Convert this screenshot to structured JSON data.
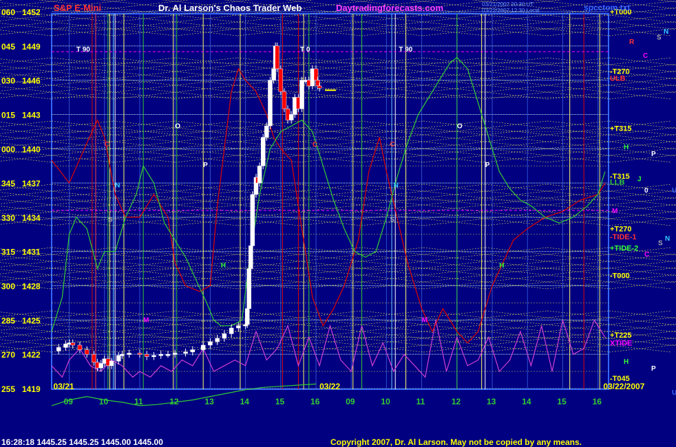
{
  "header": {
    "instrument": "S&P E-Mini",
    "site_title": "Dr. Al Larson's Chaos Trader Web",
    "site_url": "Daytradingforecasts.com",
    "date_line1": "03/21/2007 20:30 UT",
    "date_line2": "03/22/2007 12:30 Local",
    "file_name": "spcctom.txt"
  },
  "footer": {
    "quote": "16:28:18  1445.25 1445.25 1445.00 1445.00",
    "copyright": "Copyright 2007, Dr. Al Larson. May not be copied by any means."
  },
  "colors": {
    "background": "#000080",
    "price_up": "#ffffff",
    "price_down": "#ff0000",
    "grid_yellow": "#ffff66",
    "green_line": "#33cc33",
    "red_line": "#e00000",
    "magenta_line": "#d040d0",
    "axis_blue": "#3366ff",
    "label_red": "#ff3333",
    "label_magenta": "#ff00ff",
    "label_cyan": "#33ccff",
    "label_yellow": "#ffff00"
  },
  "chart_data": {
    "type": "line",
    "title": "S&P E-Mini",
    "y_ticks": [
      {
        "left": "060",
        "price": "1452",
        "value": 1452
      },
      {
        "left": "045",
        "price": "1449",
        "value": 1449
      },
      {
        "left": "030",
        "price": "1446",
        "value": 1446
      },
      {
        "left": "015",
        "price": "1443",
        "value": 1443
      },
      {
        "left": "000",
        "price": "1440",
        "value": 1440
      },
      {
        "left": "345",
        "price": "1437",
        "value": 1437
      },
      {
        "left": "330",
        "price": "1434",
        "value": 1434
      },
      {
        "left": "315",
        "price": "1431",
        "value": 1431
      },
      {
        "left": "300",
        "price": "1428",
        "value": 1428
      },
      {
        "left": "285",
        "price": "1425",
        "value": 1425
      },
      {
        "left": "270",
        "price": "1422",
        "value": 1422
      },
      {
        "left": "255",
        "price": "1419",
        "value": 1419
      }
    ],
    "ylim": [
      1419,
      1452
    ],
    "xlim": [
      8.5,
      24.3
    ],
    "x_ticks": [
      {
        "label": "09",
        "x": 9
      },
      {
        "label": "10",
        "x": 10
      },
      {
        "label": "11",
        "x": 11
      },
      {
        "label": "12",
        "x": 12
      },
      {
        "label": "13",
        "x": 13
      },
      {
        "label": "14",
        "x": 14
      },
      {
        "label": "15",
        "x": 15
      },
      {
        "label": "16",
        "x": 16
      },
      {
        "label": "09",
        "x": 17
      },
      {
        "label": "10",
        "x": 18
      },
      {
        "label": "11",
        "x": 19
      },
      {
        "label": "12",
        "x": 20
      },
      {
        "label": "13",
        "x": 21
      },
      {
        "label": "14",
        "x": 22
      },
      {
        "label": "15",
        "x": 23
      },
      {
        "label": "16",
        "x": 24
      }
    ],
    "date_labels": [
      {
        "text": "03/21",
        "x": 8.55,
        "color": "#ffff00"
      },
      {
        "text": "03/22",
        "x": 16.1,
        "color": "#ffff00"
      },
      {
        "text": "03/22/2007",
        "x": 24.15,
        "color": "#ffff00"
      }
    ],
    "price_series": {
      "name": "price",
      "x": [
        8.5,
        8.7,
        8.9,
        9.0,
        9.1,
        9.3,
        9.5,
        9.7,
        9.8,
        9.9,
        10.0,
        10.1,
        10.2,
        10.4,
        10.5,
        10.7,
        11.0,
        11.2,
        11.4,
        11.6,
        11.8,
        12.0,
        12.3,
        12.5,
        12.8,
        13.0,
        13.2,
        13.4,
        13.6,
        13.8,
        14.0,
        14.05,
        14.1,
        14.15,
        14.2,
        14.3,
        14.35,
        14.4,
        14.5,
        14.6,
        14.7,
        14.8,
        14.85,
        14.9,
        15.0,
        15.1,
        15.2,
        15.3,
        15.4,
        15.5,
        15.6,
        15.7,
        15.8,
        15.9,
        16.0,
        16.05,
        16.1
      ],
      "values": [
        1422.3,
        1422.6,
        1422.9,
        1423.0,
        1422.8,
        1422.4,
        1422.0,
        1421.3,
        1420.8,
        1421.2,
        1421.6,
        1421.0,
        1421.4,
        1421.9,
        1422.0,
        1422.1,
        1422.0,
        1421.8,
        1421.9,
        1422.0,
        1422.0,
        1422.1,
        1422.2,
        1422.4,
        1422.8,
        1423.1,
        1423.4,
        1423.8,
        1424.3,
        1424.5,
        1424.6,
        1426.0,
        1429.5,
        1431.5,
        1436.0,
        1437.5,
        1437.0,
        1438.5,
        1441.0,
        1442.0,
        1446.0,
        1447.0,
        1449.0,
        1447.0,
        1445.0,
        1443.5,
        1442.5,
        1443.0,
        1444.5,
        1443.5,
        1446.0,
        1446.0,
        1445.5,
        1447.0,
        1446.0,
        1445.5,
        1445.3
      ]
    },
    "red_flux": {
      "x": [
        8.5,
        9.0,
        9.5,
        9.8,
        10.0,
        10.3,
        10.6,
        11.0,
        11.4,
        11.8,
        12.0,
        12.3,
        12.7,
        13.0,
        13.2,
        13.4,
        13.6,
        13.8,
        14.0,
        14.3,
        14.6,
        14.8,
        15.0,
        15.3,
        15.6,
        15.9,
        16.2,
        16.5,
        16.8,
        17.2,
        17.5,
        17.8,
        18.0,
        18.3,
        18.6,
        19.0,
        19.3,
        19.6,
        20.0,
        20.3,
        20.6,
        21.0,
        21.3,
        21.6,
        22.0,
        22.5,
        23.0,
        23.5,
        24.0,
        24.2
      ],
      "values": [
        1439.0,
        1437.0,
        1440.5,
        1442.5,
        1441.0,
        1436.0,
        1434.0,
        1434.0,
        1436.0,
        1434.0,
        1430.0,
        1428.0,
        1427.5,
        1428.0,
        1435.0,
        1440.0,
        1445.0,
        1447.0,
        1446.0,
        1445.0,
        1443.0,
        1441.0,
        1440.0,
        1439.0,
        1433.0,
        1427.0,
        1424.5,
        1426.0,
        1428.0,
        1432.0,
        1438.0,
        1441.0,
        1438.0,
        1434.0,
        1430.0,
        1426.0,
        1424.0,
        1426.0,
        1424.0,
        1423.0,
        1424.0,
        1428.0,
        1430.0,
        1432.0,
        1433.0,
        1434.0,
        1434.5,
        1435.5,
        1436.0,
        1437.0
      ]
    },
    "green_flux": {
      "x": [
        8.5,
        8.8,
        9.0,
        9.2,
        9.5,
        9.8,
        10.0,
        10.3,
        10.6,
        10.9,
        11.1,
        11.4,
        11.7,
        12.0,
        12.3,
        12.6,
        12.9,
        13.1,
        13.3,
        13.6,
        13.9,
        14.1,
        14.4,
        14.7,
        15.0,
        15.3,
        15.6,
        15.9,
        16.2,
        16.5,
        16.8,
        17.1,
        17.4,
        17.7,
        18.0,
        18.3,
        18.6,
        18.9,
        19.2,
        19.5,
        19.8,
        20.0,
        20.3,
        20.6,
        20.9,
        21.2,
        21.5,
        21.8,
        22.1,
        22.5,
        22.9,
        23.3,
        23.7,
        24.0,
        24.2
      ],
      "values": [
        1424.0,
        1427.0,
        1432.5,
        1434.0,
        1433.0,
        1429.5,
        1431.0,
        1431.0,
        1434.0,
        1436.0,
        1438.5,
        1437.0,
        1433.5,
        1432.0,
        1430.5,
        1428.5,
        1426.5,
        1425.0,
        1424.5,
        1424.5,
        1425.0,
        1430.0,
        1436.0,
        1440.0,
        1441.5,
        1442.0,
        1442.5,
        1441.5,
        1438.5,
        1435.5,
        1433.0,
        1431.0,
        1430.5,
        1431.0,
        1434.0,
        1437.5,
        1440.5,
        1443.0,
        1444.5,
        1446.0,
        1447.5,
        1448.0,
        1447.0,
        1444.0,
        1441.0,
        1438.0,
        1436.5,
        1435.5,
        1435.0,
        1434.0,
        1433.5,
        1434.0,
        1435.0,
        1436.0,
        1438.0
      ]
    },
    "magenta_flux": {
      "x": [
        8.5,
        8.8,
        9.0,
        9.3,
        9.6,
        9.9,
        10.2,
        10.5,
        10.8,
        11.0,
        11.3,
        11.6,
        11.9,
        12.2,
        12.5,
        12.8,
        13.1,
        13.4,
        13.7,
        14.0,
        14.3,
        14.6,
        14.9,
        15.2,
        15.5,
        15.8,
        16.1,
        16.4,
        16.7,
        17.0,
        17.3,
        17.6,
        17.9,
        18.2,
        18.5,
        18.8,
        19.1,
        19.4,
        19.7,
        20.0,
        20.3,
        20.6,
        20.9,
        21.2,
        21.5,
        21.8,
        22.1,
        22.4,
        22.7,
        23.0,
        23.3,
        23.6,
        23.9,
        24.2
      ],
      "values": [
        1421.0,
        1420.0,
        1421.5,
        1422.5,
        1421.0,
        1420.5,
        1421.5,
        1421.0,
        1420.0,
        1420.5,
        1420.0,
        1421.0,
        1420.5,
        1421.5,
        1421.0,
        1422.5,
        1420.5,
        1421.0,
        1421.5,
        1421.0,
        1424.0,
        1421.5,
        1422.5,
        1424.5,
        1421.0,
        1423.5,
        1421.0,
        1424.5,
        1421.5,
        1420.5,
        1424.5,
        1421.0,
        1423.0,
        1420.5,
        1422.0,
        1421.0,
        1420.0,
        1425.0,
        1420.5,
        1423.5,
        1421.0,
        1421.5,
        1423.5,
        1420.5,
        1421.5,
        1424.0,
        1421.0,
        1424.5,
        1420.5,
        1425.0,
        1422.0,
        1422.5,
        1425.0,
        1423.5
      ]
    },
    "bottom_green": {
      "x": [
        8.5,
        9.0,
        9.5,
        10.0,
        10.5,
        11.0,
        11.5,
        12.0,
        12.5,
        13.0,
        13.5,
        14.0,
        14.5,
        15.0,
        15.5,
        16.0
      ],
      "values": [
        1417.5,
        1418.0,
        1418.3,
        1418.0,
        1417.8,
        1417.5,
        1417.6,
        1417.8,
        1418.0,
        1418.3,
        1418.6,
        1418.9,
        1419.1,
        1419.2,
        1419.3,
        1419.4
      ]
    },
    "vertical_lines": [
      {
        "x": 9.65,
        "color": "#e00000"
      },
      {
        "x": 9.75,
        "color": "#ff4040"
      },
      {
        "x": 10.1,
        "color": "#33cc33"
      },
      {
        "x": 10.15,
        "color": "#ffff66"
      },
      {
        "x": 10.25,
        "color": "#66ccff"
      },
      {
        "x": 10.3,
        "color": "#ffffff"
      },
      {
        "x": 10.55,
        "color": "#ffff66"
      },
      {
        "x": 11.1,
        "color": "#33cc33"
      },
      {
        "x": 11.95,
        "color": "#ffff66"
      },
      {
        "x": 12.05,
        "color": "#33cc33"
      },
      {
        "x": 12.8,
        "color": "#ffff66"
      },
      {
        "x": 13.85,
        "color": "#ffff66"
      },
      {
        "x": 15.05,
        "color": "#e00000"
      },
      {
        "x": 15.5,
        "color": "#e00000"
      },
      {
        "x": 15.65,
        "color": "#ffff66"
      },
      {
        "x": 15.8,
        "color": "#33cc33"
      },
      {
        "x": 17.05,
        "color": "#ffff66"
      },
      {
        "x": 17.3,
        "color": "#33cc33"
      },
      {
        "x": 18.15,
        "color": "#66ccff"
      },
      {
        "x": 18.25,
        "color": "#ffffff"
      },
      {
        "x": 18.55,
        "color": "#ffff66"
      },
      {
        "x": 20.0,
        "color": "#33cc33"
      },
      {
        "x": 20.7,
        "color": "#ffff66"
      },
      {
        "x": 20.8,
        "color": "#ffffff"
      },
      {
        "x": 23.2,
        "color": "#ffff66"
      },
      {
        "x": 23.6,
        "color": "#e00000"
      },
      {
        "x": 24.05,
        "color": "#ffff66"
      }
    ],
    "right_labels": [
      {
        "text": "+T000",
        "price": 1452,
        "color": "#ffff00"
      },
      {
        "text": "-T270",
        "price": 1446.8,
        "color": "#ffff00"
      },
      {
        "text": "ULB",
        "price": 1446.2,
        "color": "#ff3333"
      },
      {
        "text": "+T315",
        "price": 1441.8,
        "color": "#ffff00"
      },
      {
        "text": "-T315",
        "price": 1437.6,
        "color": "#ffff00"
      },
      {
        "text": "LLB",
        "price": 1437.1,
        "color": "#33cc33"
      },
      {
        "text": "+T270",
        "price": 1433.0,
        "color": "#ffff00"
      },
      {
        "text": "-TIDE-1",
        "price": 1432.3,
        "color": "#ff3333"
      },
      {
        "text": "+TIDE-2",
        "price": 1431.3,
        "color": "#33ff33"
      },
      {
        "text": "-T000",
        "price": 1428.9,
        "color": "#ffff00"
      },
      {
        "text": "+T225",
        "price": 1423.7,
        "color": "#ffff00"
      },
      {
        "text": "XTIDE",
        "price": 1423.0,
        "color": "#ff00ff"
      },
      {
        "text": "-T045",
        "price": 1419.9,
        "color": "#ffff00"
      }
    ],
    "annotations": [
      {
        "text": "T 90",
        "x": 9.2,
        "price": 1448.5,
        "color": "#ffffff"
      },
      {
        "text": "T 0",
        "x": 15.55,
        "price": 1448.5,
        "color": "#ffffff"
      },
      {
        "text": "T 90",
        "x": 18.35,
        "price": 1448.5,
        "color": "#ffffff"
      },
      {
        "text": "O",
        "x": 12.0,
        "price": 1441.8,
        "color": "#ffffff"
      },
      {
        "text": "O",
        "x": 20.0,
        "price": 1441.8,
        "color": "#ffffff"
      },
      {
        "text": "P",
        "x": 12.8,
        "price": 1438.4,
        "color": "#ffffff"
      },
      {
        "text": "P",
        "x": 20.8,
        "price": 1438.4,
        "color": "#ffffff"
      },
      {
        "text": "C",
        "x": 10.0,
        "price": 1440.2,
        "color": "#ff3333"
      },
      {
        "text": "C",
        "x": 15.9,
        "price": 1440.2,
        "color": "#ff3333"
      },
      {
        "text": "C",
        "x": 18.1,
        "price": 1440.2,
        "color": "#ff3333"
      },
      {
        "text": "N",
        "x": 10.3,
        "price": 1436.6,
        "color": "#33ccff"
      },
      {
        "text": "N",
        "x": 18.2,
        "price": 1436.6,
        "color": "#33ccff"
      },
      {
        "text": "S",
        "x": 10.1,
        "price": 1433.6,
        "color": "#aaaaaa"
      },
      {
        "text": "S",
        "x": 18.1,
        "price": 1433.6,
        "color": "#aaaaaa"
      },
      {
        "text": "M",
        "x": 11.1,
        "price": 1424.8,
        "color": "#ff00ff"
      },
      {
        "text": "M",
        "x": 19.0,
        "price": 1424.8,
        "color": "#ff00ff"
      },
      {
        "text": "H",
        "x": 13.3,
        "price": 1429.6,
        "color": "#33ff33"
      },
      {
        "text": "H",
        "x": 21.2,
        "price": 1429.6,
        "color": "#33ff33"
      }
    ],
    "planet_labels": [
      {
        "text": "R",
        "dx": 30,
        "price": 1449.4,
        "color": "#ff3333"
      },
      {
        "text": "C",
        "dx": 50,
        "price": 1448.2,
        "color": "#ff00ff"
      },
      {
        "text": "S",
        "dx": 70,
        "price": 1449.8,
        "color": "#aaaaaa"
      },
      {
        "text": "N",
        "dx": 80,
        "price": 1450.3,
        "color": "#33ccff"
      },
      {
        "text": "H",
        "dx": 22,
        "price": 1440.2,
        "color": "#33ff33"
      },
      {
        "text": "P",
        "dx": 62,
        "price": 1439.6,
        "color": "#ffffff"
      },
      {
        "text": "J",
        "dx": 42,
        "price": 1437.4,
        "color": "#33ff33"
      },
      {
        "text": "0",
        "dx": 52,
        "price": 1436.4,
        "color": "#ffffff"
      },
      {
        "text": "U",
        "dx": 92,
        "price": 1436.4,
        "color": "#3366ff"
      },
      {
        "text": "M",
        "dx": 5,
        "price": 1434.6,
        "color": "#ff00ff"
      },
      {
        "text": "S",
        "dx": 72,
        "price": 1431.8,
        "color": "#aaaaaa"
      },
      {
        "text": "N",
        "dx": 82,
        "price": 1432.2,
        "color": "#33ccff"
      },
      {
        "text": "C",
        "dx": 52,
        "price": 1430.8,
        "color": "#ff00ff"
      },
      {
        "text": "H",
        "dx": 22,
        "price": 1421.4,
        "color": "#33ff33"
      },
      {
        "text": "P",
        "dx": 62,
        "price": 1420.8,
        "color": "#ffffff"
      },
      {
        "text": "U",
        "dx": 92,
        "price": 1418.7,
        "color": "#3366ff"
      }
    ],
    "grid": true,
    "xlabel": "",
    "ylabel": ""
  }
}
